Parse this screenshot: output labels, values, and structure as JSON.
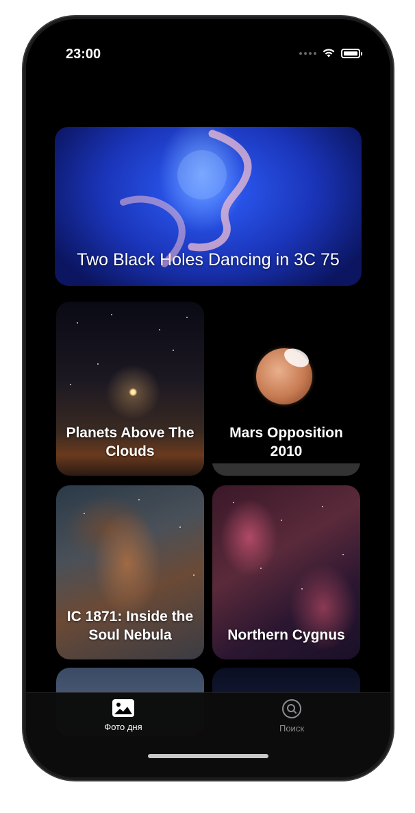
{
  "status_bar": {
    "time": "23:00"
  },
  "cards": [
    {
      "title": "Two Black Holes Dancing in 3C 75"
    },
    {
      "title": "Planets Above The Clouds"
    },
    {
      "title": "Mars Opposition 2010"
    },
    {
      "title": "IC 1871: Inside the Soul Nebula"
    },
    {
      "title": "Northern Cygnus"
    }
  ],
  "tab_bar": {
    "tabs": [
      {
        "label": "Фото дня",
        "icon": "photo-icon",
        "selected": true
      },
      {
        "label": "Поиск",
        "icon": "search-icon",
        "selected": false
      }
    ]
  },
  "colors": {
    "background": "#000000",
    "tab_active": "#ffffff",
    "tab_inactive": "#8e8e93"
  }
}
